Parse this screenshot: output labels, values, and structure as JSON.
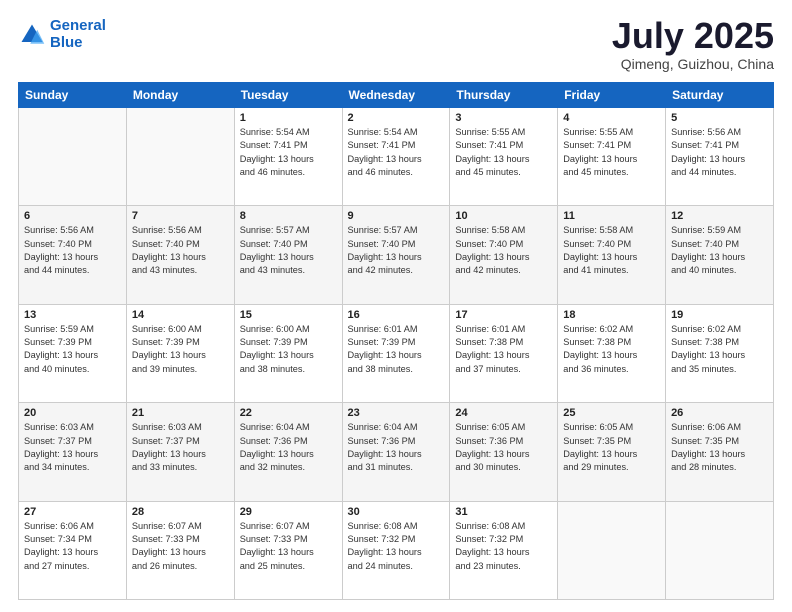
{
  "header": {
    "logo_line1": "General",
    "logo_line2": "Blue",
    "month": "July 2025",
    "location": "Qimeng, Guizhou, China"
  },
  "weekdays": [
    "Sunday",
    "Monday",
    "Tuesday",
    "Wednesday",
    "Thursday",
    "Friday",
    "Saturday"
  ],
  "weeks": [
    [
      {
        "day": "",
        "info": ""
      },
      {
        "day": "",
        "info": ""
      },
      {
        "day": "1",
        "info": "Sunrise: 5:54 AM\nSunset: 7:41 PM\nDaylight: 13 hours\nand 46 minutes."
      },
      {
        "day": "2",
        "info": "Sunrise: 5:54 AM\nSunset: 7:41 PM\nDaylight: 13 hours\nand 46 minutes."
      },
      {
        "day": "3",
        "info": "Sunrise: 5:55 AM\nSunset: 7:41 PM\nDaylight: 13 hours\nand 45 minutes."
      },
      {
        "day": "4",
        "info": "Sunrise: 5:55 AM\nSunset: 7:41 PM\nDaylight: 13 hours\nand 45 minutes."
      },
      {
        "day": "5",
        "info": "Sunrise: 5:56 AM\nSunset: 7:41 PM\nDaylight: 13 hours\nand 44 minutes."
      }
    ],
    [
      {
        "day": "6",
        "info": "Sunrise: 5:56 AM\nSunset: 7:40 PM\nDaylight: 13 hours\nand 44 minutes."
      },
      {
        "day": "7",
        "info": "Sunrise: 5:56 AM\nSunset: 7:40 PM\nDaylight: 13 hours\nand 43 minutes."
      },
      {
        "day": "8",
        "info": "Sunrise: 5:57 AM\nSunset: 7:40 PM\nDaylight: 13 hours\nand 43 minutes."
      },
      {
        "day": "9",
        "info": "Sunrise: 5:57 AM\nSunset: 7:40 PM\nDaylight: 13 hours\nand 42 minutes."
      },
      {
        "day": "10",
        "info": "Sunrise: 5:58 AM\nSunset: 7:40 PM\nDaylight: 13 hours\nand 42 minutes."
      },
      {
        "day": "11",
        "info": "Sunrise: 5:58 AM\nSunset: 7:40 PM\nDaylight: 13 hours\nand 41 minutes."
      },
      {
        "day": "12",
        "info": "Sunrise: 5:59 AM\nSunset: 7:40 PM\nDaylight: 13 hours\nand 40 minutes."
      }
    ],
    [
      {
        "day": "13",
        "info": "Sunrise: 5:59 AM\nSunset: 7:39 PM\nDaylight: 13 hours\nand 40 minutes."
      },
      {
        "day": "14",
        "info": "Sunrise: 6:00 AM\nSunset: 7:39 PM\nDaylight: 13 hours\nand 39 minutes."
      },
      {
        "day": "15",
        "info": "Sunrise: 6:00 AM\nSunset: 7:39 PM\nDaylight: 13 hours\nand 38 minutes."
      },
      {
        "day": "16",
        "info": "Sunrise: 6:01 AM\nSunset: 7:39 PM\nDaylight: 13 hours\nand 38 minutes."
      },
      {
        "day": "17",
        "info": "Sunrise: 6:01 AM\nSunset: 7:38 PM\nDaylight: 13 hours\nand 37 minutes."
      },
      {
        "day": "18",
        "info": "Sunrise: 6:02 AM\nSunset: 7:38 PM\nDaylight: 13 hours\nand 36 minutes."
      },
      {
        "day": "19",
        "info": "Sunrise: 6:02 AM\nSunset: 7:38 PM\nDaylight: 13 hours\nand 35 minutes."
      }
    ],
    [
      {
        "day": "20",
        "info": "Sunrise: 6:03 AM\nSunset: 7:37 PM\nDaylight: 13 hours\nand 34 minutes."
      },
      {
        "day": "21",
        "info": "Sunrise: 6:03 AM\nSunset: 7:37 PM\nDaylight: 13 hours\nand 33 minutes."
      },
      {
        "day": "22",
        "info": "Sunrise: 6:04 AM\nSunset: 7:36 PM\nDaylight: 13 hours\nand 32 minutes."
      },
      {
        "day": "23",
        "info": "Sunrise: 6:04 AM\nSunset: 7:36 PM\nDaylight: 13 hours\nand 31 minutes."
      },
      {
        "day": "24",
        "info": "Sunrise: 6:05 AM\nSunset: 7:36 PM\nDaylight: 13 hours\nand 30 minutes."
      },
      {
        "day": "25",
        "info": "Sunrise: 6:05 AM\nSunset: 7:35 PM\nDaylight: 13 hours\nand 29 minutes."
      },
      {
        "day": "26",
        "info": "Sunrise: 6:06 AM\nSunset: 7:35 PM\nDaylight: 13 hours\nand 28 minutes."
      }
    ],
    [
      {
        "day": "27",
        "info": "Sunrise: 6:06 AM\nSunset: 7:34 PM\nDaylight: 13 hours\nand 27 minutes."
      },
      {
        "day": "28",
        "info": "Sunrise: 6:07 AM\nSunset: 7:33 PM\nDaylight: 13 hours\nand 26 minutes."
      },
      {
        "day": "29",
        "info": "Sunrise: 6:07 AM\nSunset: 7:33 PM\nDaylight: 13 hours\nand 25 minutes."
      },
      {
        "day": "30",
        "info": "Sunrise: 6:08 AM\nSunset: 7:32 PM\nDaylight: 13 hours\nand 24 minutes."
      },
      {
        "day": "31",
        "info": "Sunrise: 6:08 AM\nSunset: 7:32 PM\nDaylight: 13 hours\nand 23 minutes."
      },
      {
        "day": "",
        "info": ""
      },
      {
        "day": "",
        "info": ""
      }
    ]
  ]
}
